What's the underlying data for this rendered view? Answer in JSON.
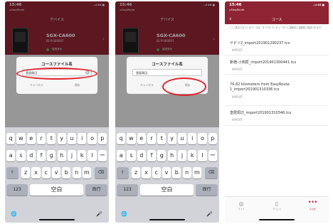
{
  "status_bar": {
    "time": "15:46",
    "back_app": "◂ EasyRoute",
    "icons": "..ıl 4G ■"
  },
  "device_screen": {
    "title": "デバイス",
    "device_name": "SGX-CA600",
    "device_id": "ID:P-000007",
    "device_status": "接続済み"
  },
  "dialog": {
    "title": "コースファイル名",
    "input_value": "皇居周辺",
    "cancel_label": "キャンセル",
    "save_label": "保存"
  },
  "keyboard": {
    "row1": [
      "q",
      "w",
      "e",
      "r",
      "t",
      "y",
      "u",
      "i",
      "o",
      "p"
    ],
    "row2": [
      "a",
      "s",
      "d",
      "f",
      "g",
      "h",
      "j",
      "k",
      "l",
      "ー"
    ],
    "row3": [
      "z",
      "x",
      "c",
      "v",
      "b",
      "n",
      "m"
    ],
    "shift": "⇧",
    "delete": "⌫",
    "numbers": "123",
    "space": "空白",
    "return": "改行",
    "globe": "🌐",
    "mic": "🎤"
  },
  "course_screen": {
    "title": "コース",
    "description": "ここに表示されているコースは、サイクルコンピューターに接続中に自動的に転送されます。",
    "routes": [
      {
        "name": "ヤビツ2_import201901290237.tcx",
        "tag": "IMPORT"
      },
      {
        "name": "新宿-小田原_import201901300441.tcx",
        "tag": "IMPORT"
      },
      {
        "name": "79.82 kilometers from EasyRoute-1_import201901310336.tcx",
        "tag": "IMPORT"
      },
      {
        "name": "皇居周辺_import201901310346.tcx",
        "tag": "IMPORT"
      }
    ],
    "tabs": [
      {
        "icon": "◎",
        "label": "ライブ"
      },
      {
        "icon": "▯",
        "label": "デバイス"
      },
      {
        "icon": "•••",
        "label": "その他"
      }
    ]
  }
}
